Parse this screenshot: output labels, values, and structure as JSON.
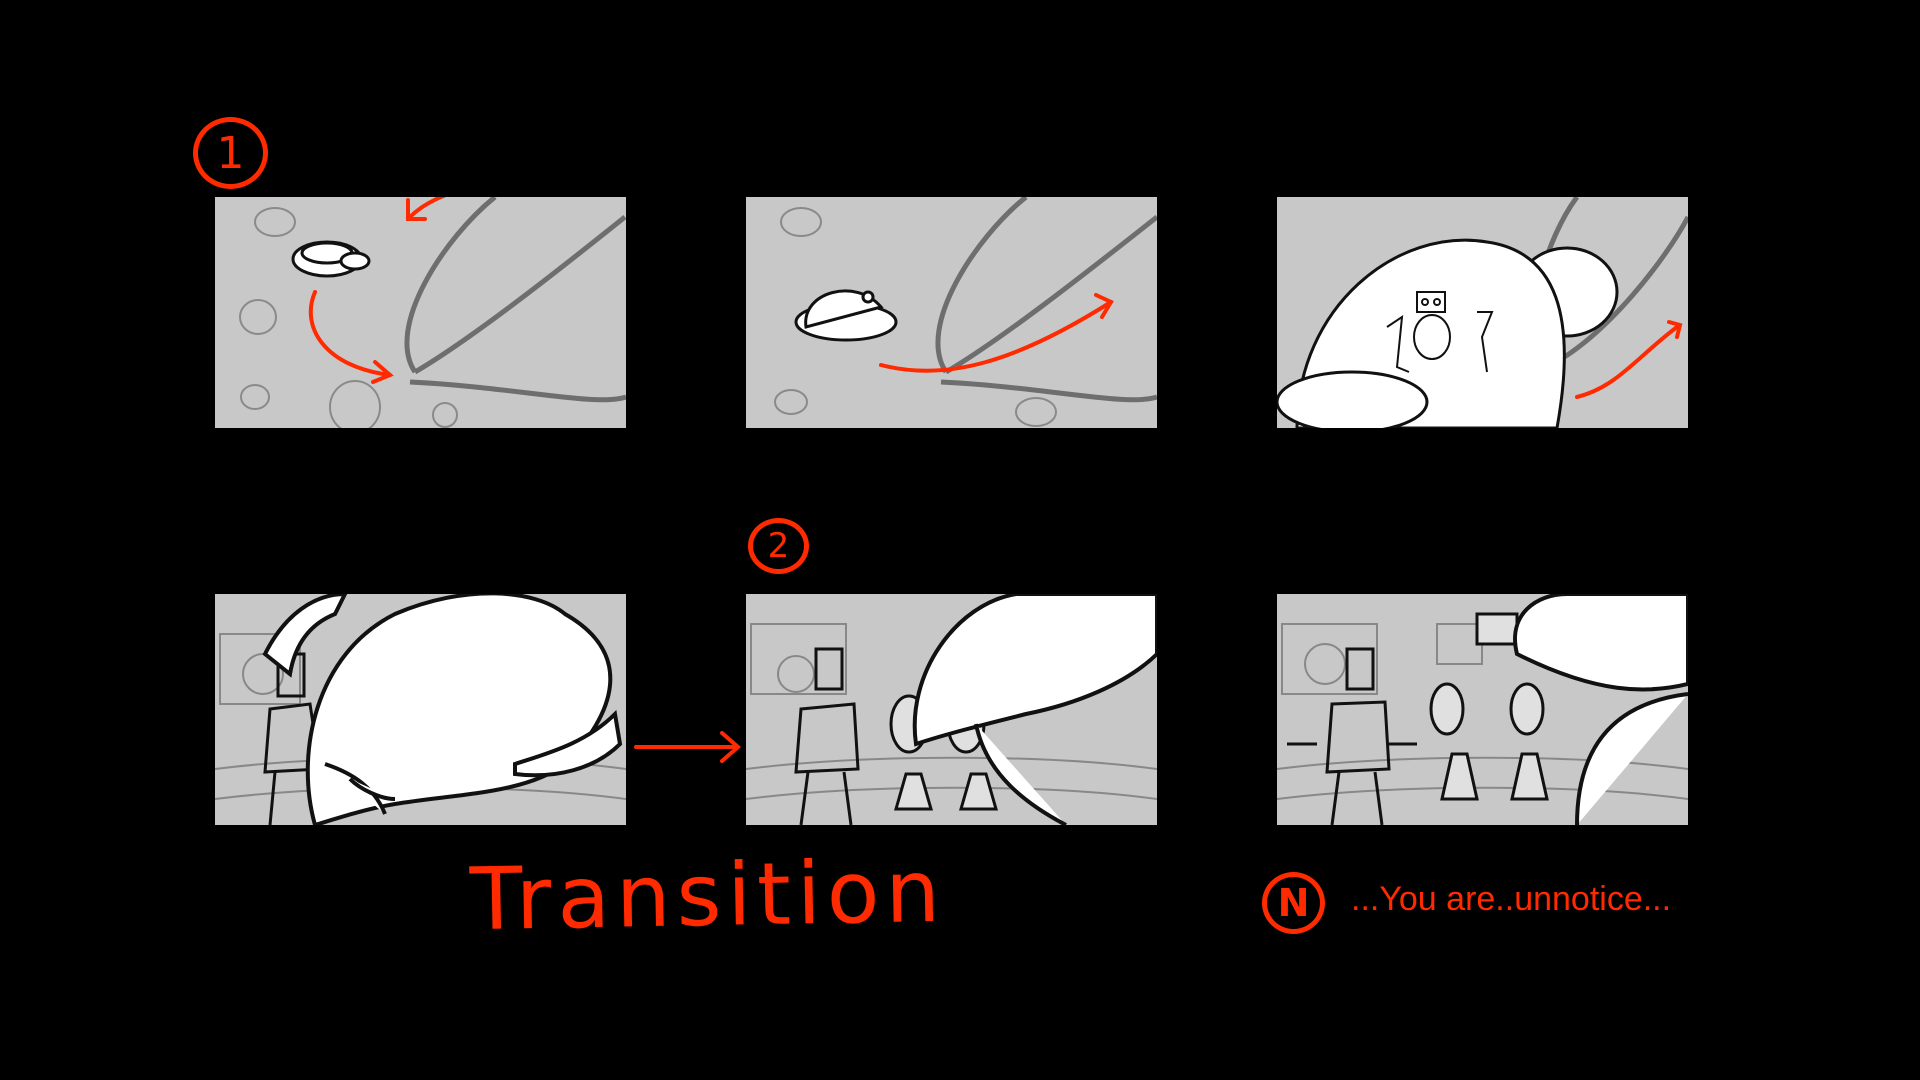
{
  "markers": {
    "scene1": "1",
    "scene2": "2",
    "note": "N"
  },
  "captions": {
    "transition": "Transition",
    "note_text": "...You are..unnotice..."
  },
  "colors": {
    "background": "#000000",
    "panel": "#c8c8c8",
    "annotation": "#ff2a00",
    "sketch_line": "#1a1a1a"
  },
  "panels": [
    {
      "id": "panel-1",
      "row": 1,
      "content": "small saucer among asteroids"
    },
    {
      "id": "panel-2",
      "row": 1,
      "content": "saucer flying past planet ring"
    },
    {
      "id": "panel-3",
      "row": 1,
      "content": "close up of saucer dome with robots"
    },
    {
      "id": "panel-4",
      "row": 2,
      "content": "man beside large ship hull"
    },
    {
      "id": "panel-5",
      "row": 2,
      "content": "man and robot behind ship"
    },
    {
      "id": "panel-6",
      "row": 2,
      "content": "man gesturing near robot"
    }
  ]
}
